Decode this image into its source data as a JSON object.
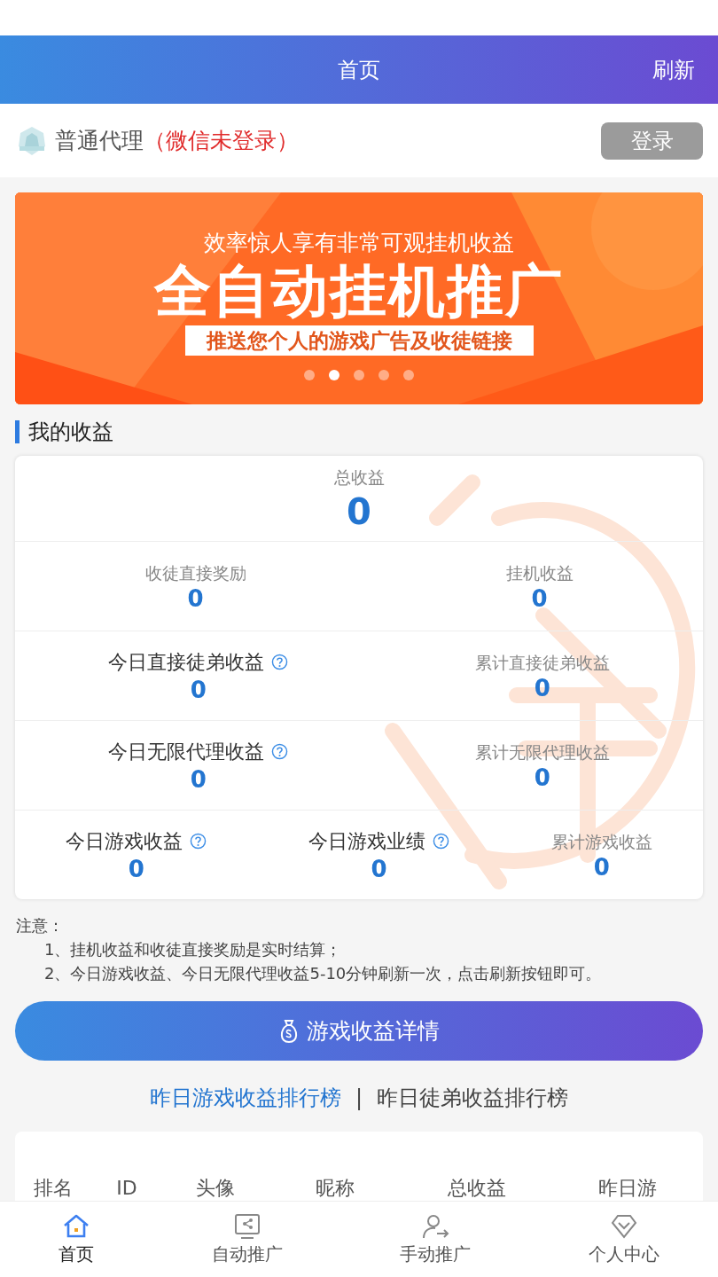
{
  "header": {
    "title": "首页",
    "action": "刷新"
  },
  "user": {
    "role": "普通代理",
    "status": "（微信未登录）",
    "login_button": "登录"
  },
  "banner": {
    "subtitle": "效率惊人享有非常可观挂机收益",
    "title": "全自动挂机推广",
    "caption": "推送您个人的游戏广告及收徒链接",
    "dots": [
      {
        "selected": false
      },
      {
        "selected": true
      },
      {
        "selected": false
      },
      {
        "selected": false
      },
      {
        "selected": false
      }
    ]
  },
  "section_title": "我的收益",
  "earnings": [
    [
      {
        "label": "总收益",
        "value": "0",
        "kind": "total",
        "help": false
      }
    ],
    [
      {
        "label": "收徒直接奖励",
        "value": "0",
        "kind": "stat",
        "help": false
      },
      {
        "label": "挂机收益",
        "value": "0",
        "kind": "stat",
        "help": false
      }
    ],
    [
      {
        "label": "今日直接徒弟收益",
        "value": "0",
        "kind": "stat",
        "help": true
      },
      {
        "label": "累计直接徒弟收益",
        "value": "0",
        "kind": "stat",
        "help": false
      }
    ],
    [
      {
        "label": "今日无限代理收益",
        "value": "0",
        "kind": "stat",
        "help": true
      },
      {
        "label": "累计无限代理收益",
        "value": "0",
        "kind": "stat",
        "help": false
      }
    ],
    [
      {
        "label": "今日游戏收益",
        "value": "0",
        "kind": "stat",
        "help": true
      },
      {
        "label": "今日游戏业绩",
        "value": "0",
        "kind": "stat",
        "help": true
      },
      {
        "label": "累计游戏收益",
        "value": "0",
        "kind": "stat",
        "help": false
      }
    ]
  ],
  "notes": {
    "title": "注意：",
    "items": [
      "1、挂机收益和收徒直接奖励是实时结算；",
      "2、今日游戏收益、今日无限代理收益5-10分钟刷新一次，点击刷新按钮即可。"
    ]
  },
  "details_button": "游戏收益详情",
  "ranking_tabs": [
    {
      "label": "昨日游戏收益排行榜",
      "selected": true
    },
    {
      "label": "昨日徒弟收益排行榜",
      "selected": false
    }
  ],
  "ranking_separator": "|",
  "table": {
    "columns": [
      "排名",
      "ID",
      "头像",
      "昵称",
      "总收益",
      "昨日游"
    ]
  },
  "bottom_nav": [
    {
      "label": "首页",
      "selected": true
    },
    {
      "label": "自动推广",
      "selected": false
    },
    {
      "label": "手动推广",
      "selected": false
    },
    {
      "label": "个人中心",
      "selected": false
    }
  ]
}
